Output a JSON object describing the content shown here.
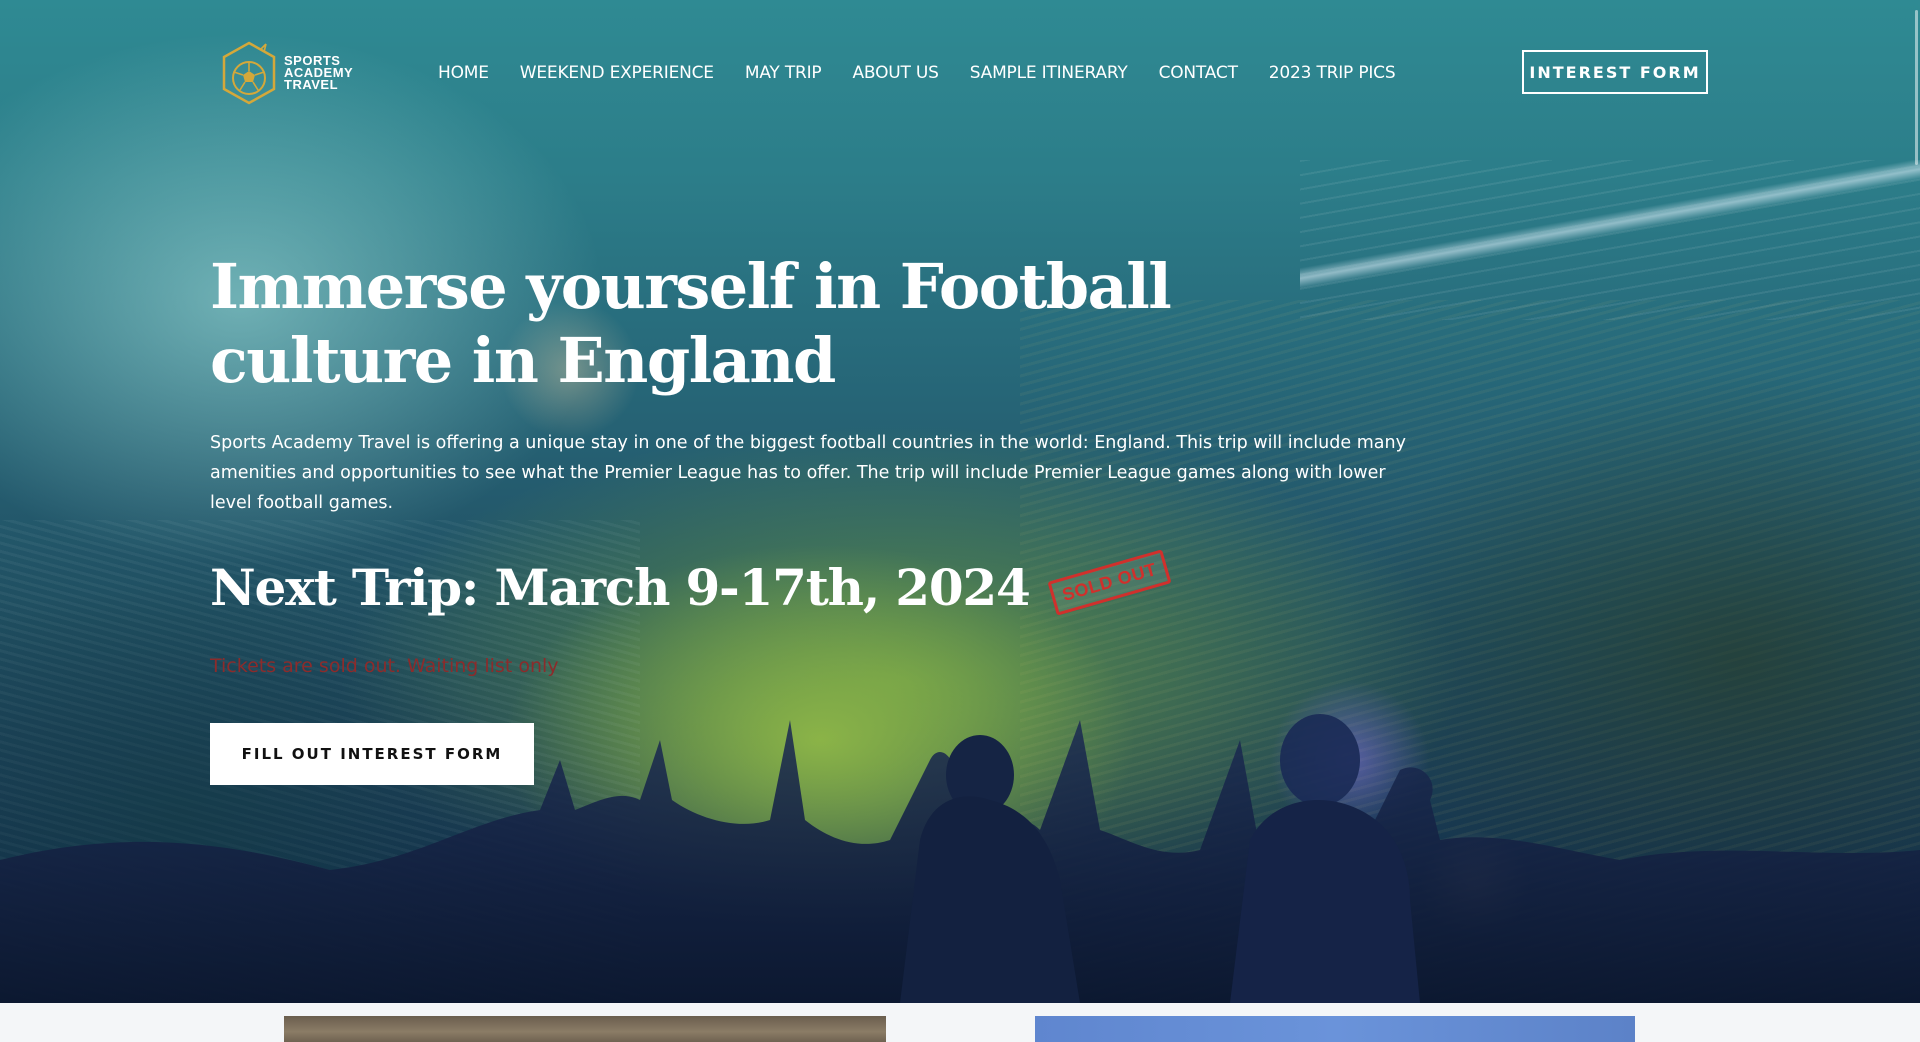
{
  "brand": {
    "logo_line1": "SPORTS",
    "logo_line2": "ACADEMY",
    "logo_line3": "TRAVEL",
    "accent_color": "#d4a83a"
  },
  "nav": {
    "items": [
      {
        "label": "HOME"
      },
      {
        "label": "WEEKEND EXPERIENCE"
      },
      {
        "label": "MAY TRIP"
      },
      {
        "label": "ABOUT US"
      },
      {
        "label": "SAMPLE ITINERARY"
      },
      {
        "label": "CONTACT"
      },
      {
        "label": "2023 TRIP PICS"
      }
    ],
    "cta_label": "INTEREST FORM"
  },
  "hero": {
    "title": "Immerse yourself in Football culture in England",
    "description": "Sports Academy Travel is offering a unique stay in one of the biggest football countries in the world: England. This trip will include many amenities and opportunities to see what the Premier League has to offer. The trip will include Premier League games along with lower level football games.",
    "next_trip": "Next Trip: March 9-17th, 2024",
    "sold_out_stamp": "SOLD OUT",
    "sold_out_note": "Tickets are sold out. Waiting list only",
    "cta_label": "FILL OUT INTEREST FORM",
    "sold_out_color": "#d0302c"
  }
}
